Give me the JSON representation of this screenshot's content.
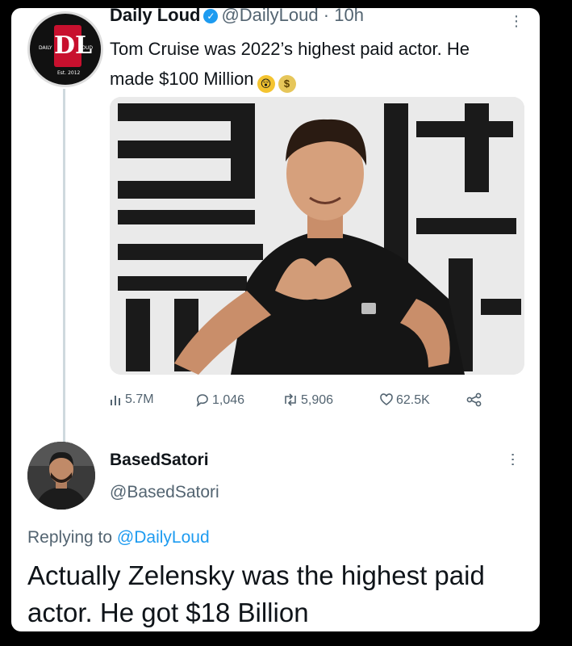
{
  "tweet": {
    "avatar_logo": {
      "letters": "DL",
      "left_text": "DAILY",
      "right_text": "LOUD",
      "est": "Est. 2012"
    },
    "display_name": "Daily Loud",
    "handle": "@DailyLoud",
    "separator": "·",
    "time": "10h",
    "text": "Tom Cruise was 2022’s highest paid actor. He made $100 Million",
    "emoji_1": "exploding-head-emoji",
    "emoji_2": "money-bag-emoji",
    "image_description_icon": "photo",
    "stats": {
      "views": "5.7M",
      "replies": "1,046",
      "retweets": "5,906",
      "likes": "62.5K"
    }
  },
  "reply": {
    "display_name": "BasedSatori",
    "handle": "@BasedSatori",
    "replying_prefix": "Replying to",
    "replying_to": "@DailyLoud",
    "text": "Actually Zelensky was the highest paid actor. He got $18 Billion"
  },
  "colors": {
    "accent": "#1d9bf0",
    "secondary_text": "#536471",
    "primary_text": "#0f1419",
    "brand_red": "#c8102e"
  }
}
